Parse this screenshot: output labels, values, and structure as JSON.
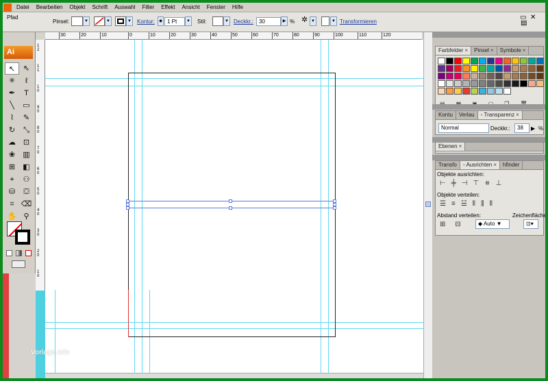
{
  "menubar": {
    "items": [
      "Datei",
      "Bearbeiten",
      "Objekt",
      "Schrift",
      "Auswahl",
      "Filter",
      "Effekt",
      "Ansicht",
      "Fenster",
      "Hilfe"
    ]
  },
  "controlbar": {
    "object_type": "Pfad",
    "brush_label": "Pinsel:",
    "stroke_label": "Kontur:",
    "stroke_value": "1 Pt",
    "style_label": "Stil:",
    "opacity_label": "Deckkr.:",
    "opacity_value": "30",
    "opacity_unit": "%",
    "transform_label": "Transformieren"
  },
  "toolbox": {
    "logo": "Ai"
  },
  "ruler": {
    "h_labels": [
      "30",
      "20",
      "10",
      "0",
      "10",
      "20",
      "30",
      "40",
      "50",
      "60",
      "70",
      "80",
      "90",
      "100",
      "110",
      "120"
    ]
  },
  "watermark": "Vorlage.info",
  "panels": {
    "swatch_tabs": [
      "Farbfelder",
      "Pinsel",
      "Symbole"
    ],
    "transparency_tabs": [
      "Kontu",
      "Verlau",
      "Transparenz"
    ],
    "blend_mode": "Normal",
    "opacity_label": "Deckkr.:",
    "opacity_value": "38",
    "opacity_unit": "%",
    "layers_tab": "Ebenen",
    "align_tabs": [
      "Transfo",
      "Ausrichten",
      "hfinder"
    ],
    "align_objects_label": "Objekte ausrichten:",
    "distribute_objects_label": "Objekte verteilen:",
    "distribute_spacing_label": "Abstand verteilen:",
    "align_to_label": "Zeichenfläche:",
    "spacing_value": "Auto"
  },
  "colors": {
    "swatches": [
      "#ffffff",
      "#000000",
      "#ff0000",
      "#ffff00",
      "#00a651",
      "#00aeef",
      "#2e3192",
      "#ec008c",
      "#f26522",
      "#ffc20e",
      "#8dc63f",
      "#00a99d",
      "#0072bc",
      "#662d91",
      "#9e005d",
      "#ed1c24",
      "#f7941d",
      "#fff200",
      "#39b54a",
      "#00a99d",
      "#0054a6",
      "#92278f",
      "#c69c6d",
      "#a67c52",
      "#8c6239",
      "#603913",
      "#7f007f",
      "#c4007a",
      "#e6005c",
      "#ff7a59",
      "#c7b299",
      "#998675",
      "#736357",
      "#534741",
      "#c69c6d",
      "#a67c52",
      "#8c6239",
      "#754c24",
      "#603913",
      "#ffffff",
      "#e6e6e6",
      "#cccccc",
      "#b3b3b3",
      "#999999",
      "#808080",
      "#666666",
      "#4d4d4d",
      "#333333",
      "#1a1a1a",
      "#000000",
      "#f9a88a",
      "#f4c07a",
      "#fbd6b2",
      "#ff9a44",
      "#ffc84a",
      "#e83a2e",
      "#b6d34a",
      "#37b3e0",
      "#8ec9e8",
      "#b5e0f0",
      "#ffffff"
    ]
  }
}
